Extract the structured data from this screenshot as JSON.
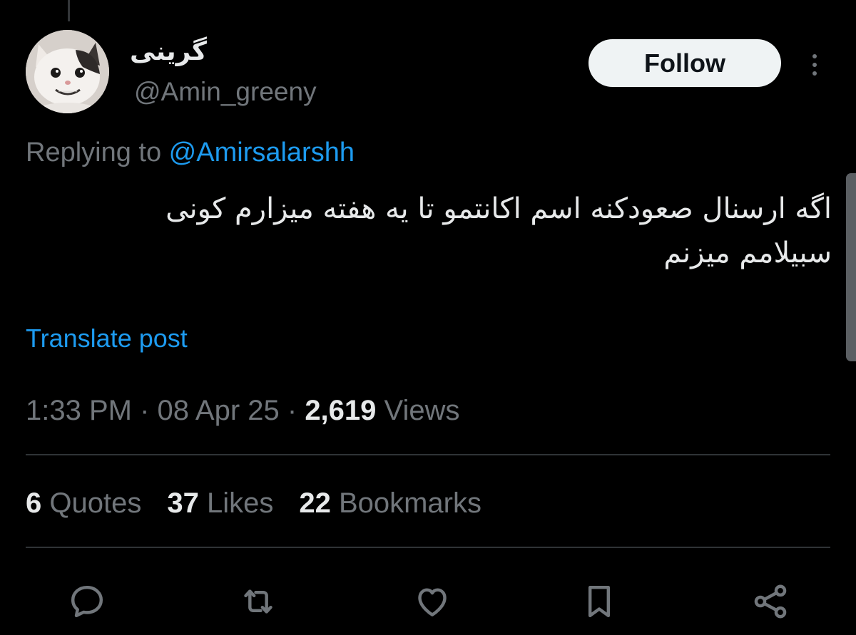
{
  "author": {
    "display_name": "گرینی",
    "handle": "@Amin_greeny"
  },
  "actions_top": {
    "follow_label": "Follow"
  },
  "reply": {
    "prefix": "Replying to ",
    "mention": "@Amirsalarshh"
  },
  "tweet": {
    "lines": [
      "اگه ارسنال صعودکنه اسم اکانتمو تا یه هفته میزارم کونی",
      "سبیلامم میزنم"
    ],
    "translate_label": "Translate post"
  },
  "meta": {
    "time": "1:33 PM",
    "separator": " · ",
    "date": "08 Apr 25",
    "views_count": "2,619",
    "views_label": " Views"
  },
  "stats": {
    "quotes_count": "6",
    "quotes_label": " Quotes",
    "likes_count": "37",
    "likes_label": " Likes",
    "bookmarks_count": "22",
    "bookmarks_label": " Bookmarks"
  },
  "action_bar": {
    "icons": [
      "reply-icon",
      "retweet-icon",
      "like-icon",
      "bookmark-icon",
      "share-icon"
    ]
  },
  "colors": {
    "background": "#000000",
    "text_primary": "#e7e9ea",
    "text_secondary": "#71767b",
    "accent": "#1d9bf0",
    "divider": "#2f3336"
  }
}
